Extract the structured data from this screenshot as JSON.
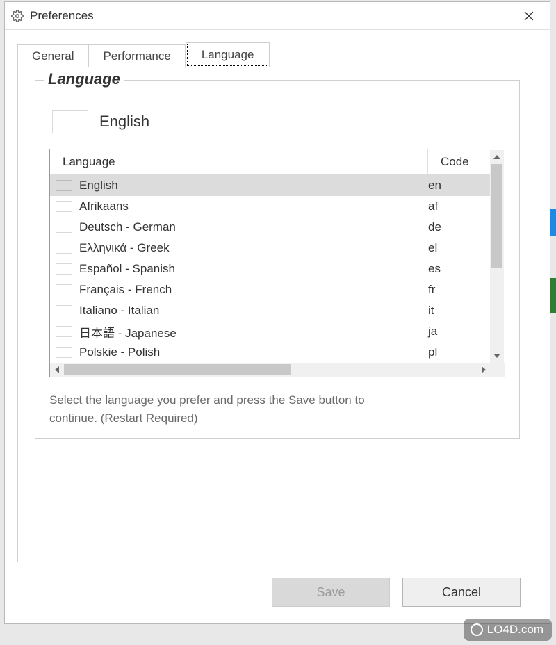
{
  "window": {
    "title": "Preferences"
  },
  "tabs": [
    {
      "label": "General",
      "active": false
    },
    {
      "label": "Performance",
      "active": false
    },
    {
      "label": "Language",
      "active": true
    }
  ],
  "group": {
    "legend": "Language"
  },
  "current": {
    "name": "English",
    "flag": "uk"
  },
  "columns": {
    "language": "Language",
    "code": "Code"
  },
  "languages": [
    {
      "name": "English",
      "code": "en",
      "flag": "uk",
      "selected": true
    },
    {
      "name": "Afrikaans",
      "code": "af",
      "flag": "za",
      "selected": false
    },
    {
      "name": "Deutsch - German",
      "code": "de",
      "flag": "de",
      "selected": false
    },
    {
      "name": "Ελληνικά - Greek",
      "code": "el",
      "flag": "gr",
      "selected": false
    },
    {
      "name": "Español - Spanish",
      "code": "es",
      "flag": "es",
      "selected": false
    },
    {
      "name": "Français - French",
      "code": "fr",
      "flag": "fr",
      "selected": false
    },
    {
      "name": "Italiano - Italian",
      "code": "it",
      "flag": "it",
      "selected": false
    },
    {
      "name": "日本語 - Japanese",
      "code": "ja",
      "flag": "jp",
      "selected": false
    },
    {
      "name": "Polskie - Polish",
      "code": "pl",
      "flag": "pl",
      "selected": false
    }
  ],
  "hint": "Select the language you prefer and press the Save button to continue. (Restart Required)",
  "buttons": {
    "save": "Save",
    "cancel": "Cancel"
  },
  "watermark": "LO4D.com"
}
